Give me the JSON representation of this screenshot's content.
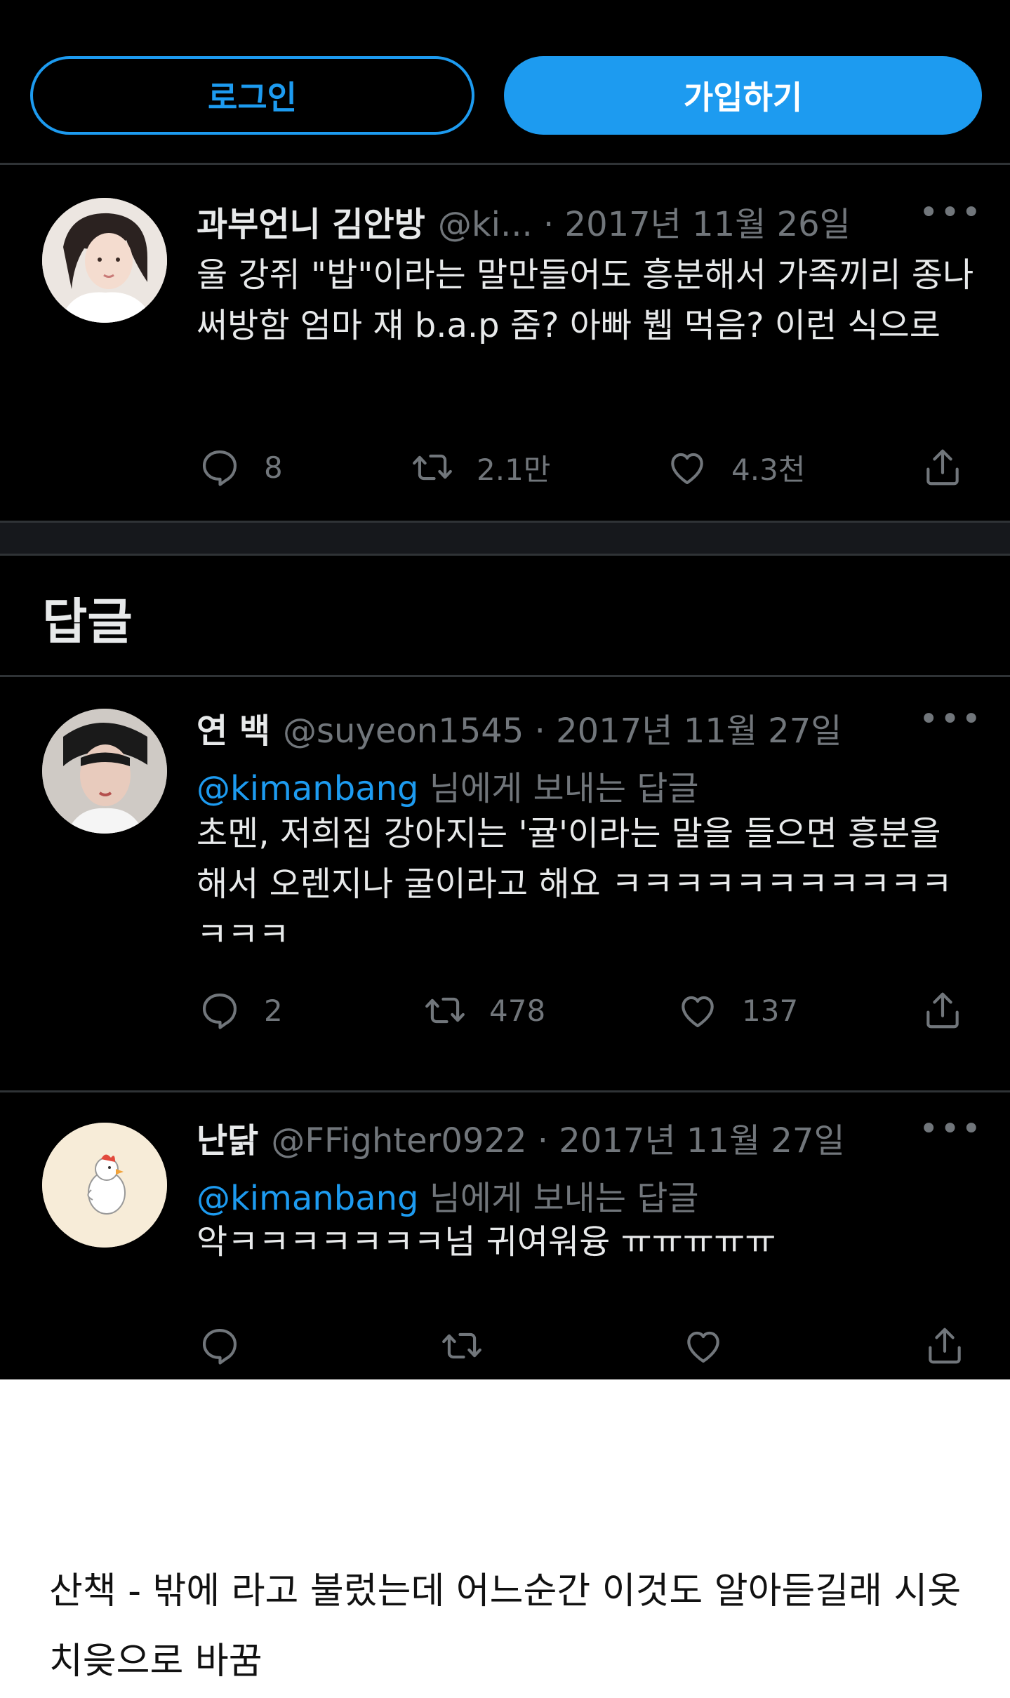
{
  "top_buttons": {
    "login_label": "로그인",
    "signup_label": "가입하기"
  },
  "main_tweet": {
    "display_name": "과부언니 김안방",
    "handle_date": "@ki...  · 2017년 11월 26일",
    "text": "울 강쥐 \"밥\"이라는 말만들어도 흥분해서 가족끼리 종나 써방함 엄마 쟤  b.a.p 줌? 아빠 뷉 먹음? 이런 식으로",
    "replies": "8",
    "retweets": "2.1만",
    "likes": "4.3천"
  },
  "replies_heading": "답글",
  "replies": [
    {
      "display_name": "연 백",
      "handle_date": "@suyeon1545 · 2017년 11월 27일",
      "mention": "@kimanbang",
      "replying_suffix": "님에게 보내는 답글",
      "text": "초멘, 저희집 강아지는 '귤'이라는 말을 들으면 흥분을 해서 오렌지나 굴이라고 해요 ㅋㅋㅋㅋㅋㅋㅋㅋㅋㅋㅋㅋㅋㅋ",
      "replies": "2",
      "retweets": "478",
      "likes": "137"
    },
    {
      "display_name": "난닭",
      "handle_date": "@FFighter0922 · 2017년 11월 27일",
      "mention": "@kimanbang",
      "replying_suffix": "님에게 보내는 답글",
      "text": "악ㅋㅋㅋㅋㅋㅋㅋ넘 귀여워융 ㅠㅠㅠㅠㅠ"
    }
  ],
  "caption": "산책 - 밖에 라고 불렀는데 어느순간 이것도 알아듣길래 시옷치읒으로 바꿈",
  "colors": {
    "accent": "#1d9bf0",
    "background": "#000000",
    "muted_text": "#71767b"
  },
  "icons": [
    "reply-icon",
    "retweet-icon",
    "like-icon",
    "share-icon",
    "more-icon"
  ]
}
